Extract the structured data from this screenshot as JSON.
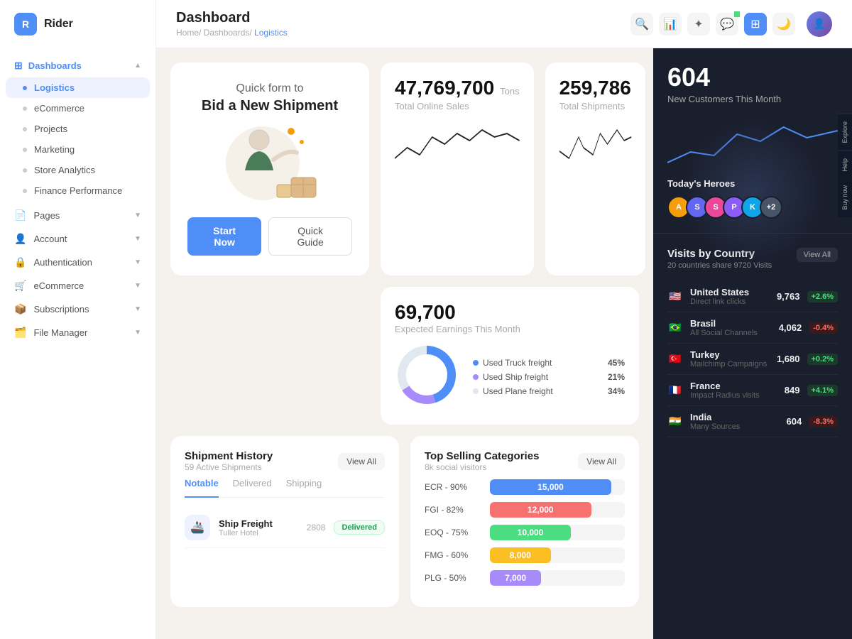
{
  "app": {
    "logo_letter": "R",
    "logo_name": "Rider"
  },
  "sidebar": {
    "sections": [
      {
        "label": "Dashboards",
        "icon": "grid-icon",
        "expanded": true,
        "items": [
          {
            "id": "logistics",
            "label": "Logistics",
            "active": true
          },
          {
            "id": "ecommerce",
            "label": "eCommerce",
            "active": false
          },
          {
            "id": "projects",
            "label": "Projects",
            "active": false
          },
          {
            "id": "marketing",
            "label": "Marketing",
            "active": false
          },
          {
            "id": "store-analytics",
            "label": "Store Analytics",
            "active": false
          },
          {
            "id": "finance-performance",
            "label": "Finance Performance",
            "active": false
          }
        ]
      },
      {
        "label": "Pages",
        "icon": "pages-icon",
        "expanded": false,
        "items": []
      },
      {
        "label": "Account",
        "icon": "account-icon",
        "expanded": false,
        "items": []
      },
      {
        "label": "Authentication",
        "icon": "auth-icon",
        "expanded": false,
        "items": []
      },
      {
        "label": "eCommerce",
        "icon": "ecom-icon",
        "expanded": false,
        "items": []
      },
      {
        "label": "Subscriptions",
        "icon": "sub-icon",
        "expanded": false,
        "items": []
      },
      {
        "label": "File Manager",
        "icon": "file-icon",
        "expanded": false,
        "items": []
      }
    ]
  },
  "topbar": {
    "title": "Dashboard",
    "breadcrumb": [
      "Home",
      "Dashboards",
      "Logistics"
    ]
  },
  "hero": {
    "title": "Quick form to",
    "subtitle": "Bid a New Shipment",
    "btn_primary": "Start Now",
    "btn_secondary": "Quick Guide"
  },
  "stats": [
    {
      "value": "47,769,700",
      "unit": "Tons",
      "label": "Total Online Sales"
    },
    {
      "value": "259,786",
      "label": "Total Shipments"
    }
  ],
  "earnings": {
    "value": "69,700",
    "label": "Expected Earnings This Month",
    "segments": [
      {
        "label": "Used Truck freight",
        "pct": "45%",
        "color": "#4f8ef7"
      },
      {
        "label": "Used Ship freight",
        "pct": "21%",
        "color": "#a78bfa"
      },
      {
        "label": "Used Plane freight",
        "pct": "34%",
        "color": "#e2e8f0"
      }
    ]
  },
  "new_customers": {
    "value": "604",
    "label": "New Customers This Month",
    "heroes_title": "Today's Heroes"
  },
  "shipment_history": {
    "title": "Shipment History",
    "subtitle": "59 Active Shipments",
    "view_all": "View All",
    "tabs": [
      "Notable",
      "Delivered",
      "Shipping"
    ],
    "active_tab": "Notable",
    "items": [
      {
        "icon": "🚢",
        "name": "Ship Freight",
        "sub": "Tuller Hotel",
        "id": "2808",
        "status": "Delivered"
      }
    ]
  },
  "categories": {
    "title": "Top Selling Categories",
    "subtitle": "8k social visitors",
    "view_all": "View All",
    "items": [
      {
        "label": "ECR - 90%",
        "value": 15000,
        "display": "15,000",
        "color": "#4f8ef7",
        "pct": 90
      },
      {
        "label": "FGI - 82%",
        "value": 12000,
        "display": "12,000",
        "color": "#f87171",
        "pct": 75
      },
      {
        "label": "EOQ - 75%",
        "value": 10000,
        "display": "10,000",
        "color": "#4ade80",
        "pct": 60
      },
      {
        "label": "FMG - 60%",
        "value": 8000,
        "display": "8,000",
        "color": "#fbbf24",
        "pct": 45
      },
      {
        "label": "PLG - 50%",
        "value": 7000,
        "display": "7,000",
        "color": "#a78bfa",
        "pct": 38
      }
    ]
  },
  "visits": {
    "title": "Visits by Country",
    "subtitle": "20 countries share 9720 Visits",
    "view_all_label": "View All",
    "countries": [
      {
        "flag": "🇺🇸",
        "name": "United States",
        "source": "Direct link clicks",
        "count": "9,763",
        "change": "+2.6%",
        "up": true
      },
      {
        "flag": "🇧🇷",
        "name": "Brasil",
        "source": "All Social Channels",
        "count": "4,062",
        "change": "-0.4%",
        "up": false
      },
      {
        "flag": "🇹🇷",
        "name": "Turkey",
        "source": "Mailchimp Campaigns",
        "count": "1,680",
        "change": "+0.2%",
        "up": true
      },
      {
        "flag": "🇫🇷",
        "name": "France",
        "source": "Impact Radius visits",
        "count": "849",
        "change": "+4.1%",
        "up": true
      },
      {
        "flag": "🇮🇳",
        "name": "India",
        "source": "Many Sources",
        "count": "604",
        "change": "-8.3%",
        "up": false
      }
    ]
  },
  "side_tabs": [
    "Explore",
    "Help",
    "Buy now"
  ],
  "heroes": [
    {
      "color": "#f59e0b",
      "letter": "A"
    },
    {
      "color": "#6366f1",
      "letter": "S",
      "img": true
    },
    {
      "color": "#ec4899",
      "letter": "S"
    },
    {
      "color": "#8b5cf6",
      "letter": "P",
      "img": true
    },
    {
      "color": "#0ea5e9",
      "letter": "K",
      "img": true
    },
    {
      "color": "#475569",
      "letter": "+2"
    }
  ]
}
